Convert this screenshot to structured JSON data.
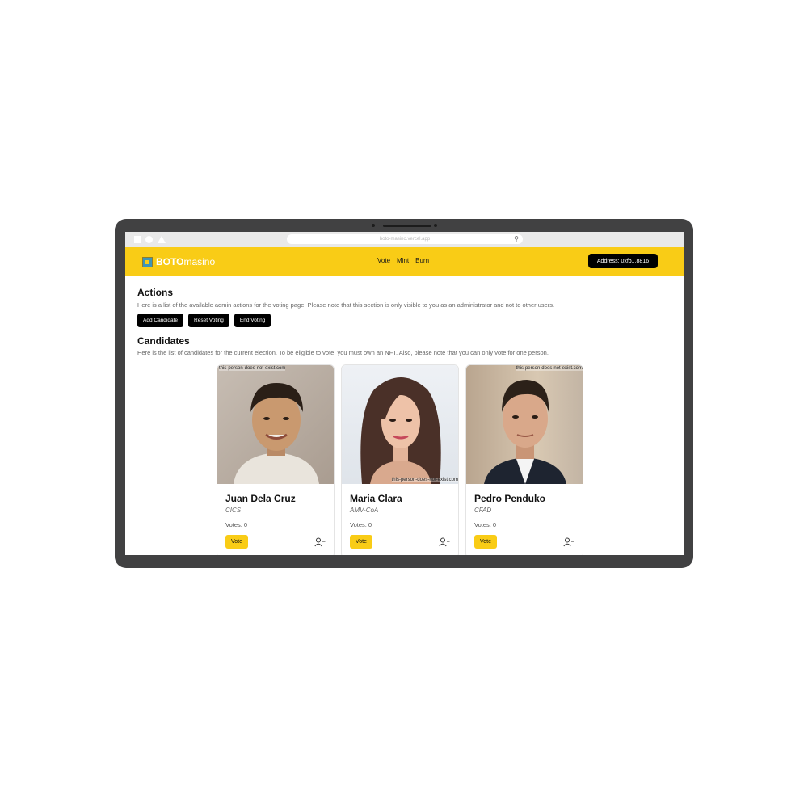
{
  "browser": {
    "url": "boto-masino.vercel.app"
  },
  "navbar": {
    "brand_primary": "BOTO",
    "brand_secondary": "masino",
    "links": [
      "Vote",
      "Mint",
      "Burn"
    ],
    "address_button": "Address: 0xfb...8816",
    "accent_color": "#f9cc16"
  },
  "actions": {
    "title": "Actions",
    "description": "Here is a list of the available admin actions for the voting page. Please note that this section is only visible to you as an administrator and not to other users.",
    "buttons": [
      "Add Candidate",
      "Reset Voting",
      "End Voting"
    ]
  },
  "candidates": {
    "title": "Candidates",
    "description": "Here is the list of candidates for the current election. To be eligible to vote, you must own an NFT. Also, please note that you can only vote for one person.",
    "items": [
      {
        "name": "Juan Dela Cruz",
        "party": "CICS",
        "votes": "Votes: 0",
        "vote_label": "Vote",
        "watermark": "this-person-does-not-exist.com"
      },
      {
        "name": "Maria Clara",
        "party": "AMV-CoA",
        "votes": "Votes: 0",
        "vote_label": "Vote",
        "watermark": "this-person-does-not-exist.com"
      },
      {
        "name": "Pedro Penduko",
        "party": "CFAD",
        "votes": "Votes: 0",
        "vote_label": "Vote",
        "watermark": "this-person-does-not-exist.com"
      }
    ]
  }
}
